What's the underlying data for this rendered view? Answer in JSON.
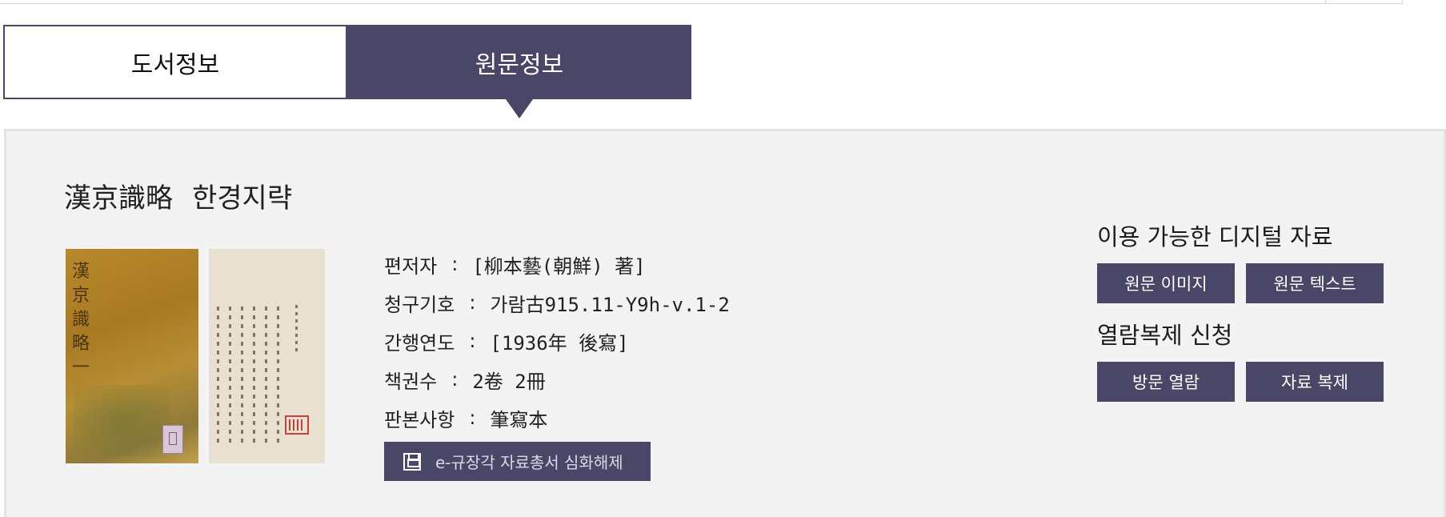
{
  "tabs": {
    "book_info": "도서정보",
    "original_info": "원문정보"
  },
  "book": {
    "title_hanja": "漢京識略",
    "title_hangul": "한경지략",
    "cover_calligraphy": "漢京識略 一",
    "fields": [
      {
        "label": "편저자",
        "value": "[柳本藝(朝鮮) 著]"
      },
      {
        "label": "청구기호",
        "value": "가람古915.11-Y9h-v.1-2"
      },
      {
        "label": "간행연도",
        "value": "[1936年 後寫]"
      },
      {
        "label": "책권수",
        "value": "2卷 2冊"
      },
      {
        "label": "판본사항",
        "value": "筆寫本"
      }
    ],
    "separator": ":"
  },
  "ebook_button": {
    "label": "e-규장각 자료총서 심화해제",
    "icon": "save-icon"
  },
  "sidebar": {
    "digital_title": "이용 가능한 디지털 자료",
    "digital_buttons": [
      "원문 이미지",
      "원문 텍스트"
    ],
    "request_title": "열람복제 신청",
    "request_buttons": [
      "방문 열람",
      "자료 복제"
    ]
  },
  "colors": {
    "accent": "#4a4668",
    "panel_bg": "#f3f3f3",
    "border": "#e3e3e3"
  }
}
